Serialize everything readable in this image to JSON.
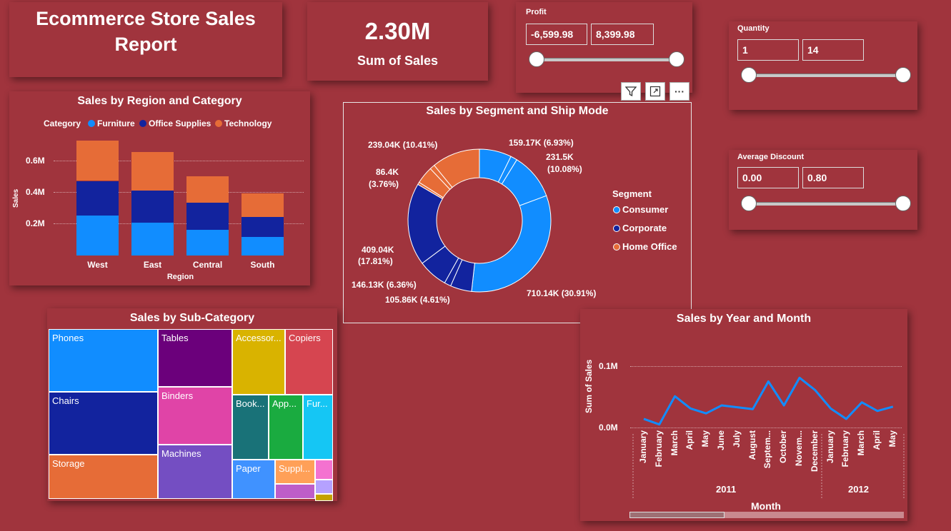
{
  "header": {
    "title_line1": "Ecommerce Store Sales",
    "title_line2": "Report"
  },
  "kpi": {
    "value": "2.30M",
    "label": "Sum of Sales"
  },
  "slicers": {
    "profit": {
      "title": "Profit",
      "min": "-6,599.98",
      "max": "8,399.98"
    },
    "quantity": {
      "title": "Quantity",
      "min": "1",
      "max": "14"
    },
    "discount": {
      "title": "Average Discount",
      "min": "0.00",
      "max": "0.80"
    }
  },
  "visual_toolbar": {
    "filter_icon": "filter-icon",
    "focus_icon": "focus-mode-icon",
    "more_icon": "more-options-icon",
    "more_label": "···"
  },
  "region_chart": {
    "title": "Sales by Region and Category",
    "legend_title": "Category",
    "legend": [
      "Furniture",
      "Office Supplies",
      "Technology"
    ],
    "ylabel": "Sales",
    "xlabel": "Region",
    "yticks": [
      "0.6M",
      "0.4M",
      "0.2M"
    ]
  },
  "segment_chart": {
    "title": "Sales by Segment and Ship Mode",
    "legend_title": "Segment",
    "legend": [
      "Consumer",
      "Corporate",
      "Home Office"
    ],
    "labels": {
      "a": "159.17K (6.93%)",
      "b1": "231.5K",
      "b2": "(10.08%)",
      "c": "710.14K (30.91%)",
      "d": "105.86K (4.61%)",
      "e": "146.13K (6.36%)",
      "f1": "409.04K",
      "f2": "(17.81%)",
      "g1": "86.4K",
      "g2": "(3.76%)",
      "h": "239.04K (10.41%)"
    }
  },
  "subcategory_chart": {
    "title": "Sales by Sub-Category",
    "tiles": {
      "phones": "Phones",
      "chairs": "Chairs",
      "storage": "Storage",
      "tables": "Tables",
      "binders": "Binders",
      "machines": "Machines",
      "accessories": "Accessor...",
      "copiers": "Copiers",
      "bookcases": "Book...",
      "appliances": "App...",
      "furnishings": "Fur...",
      "paper": "Paper",
      "supplies": "Suppl..."
    }
  },
  "month_chart": {
    "title": "Sales by Year and Month",
    "ylabel": "Sum of Sales",
    "xlabel": "Month",
    "yticks": [
      "0.1M",
      "0.0M"
    ],
    "months_2011": [
      "January",
      "February",
      "March",
      "April",
      "May",
      "June",
      "July",
      "August",
      "Septem...",
      "October",
      "Novem...",
      "December"
    ],
    "months_2012": [
      "January",
      "February",
      "March",
      "April",
      "May"
    ],
    "year_2011": "2011",
    "year_2012": "2012"
  },
  "chart_data": [
    {
      "type": "bar",
      "title": "Sales by Region and Category",
      "xlabel": "Region",
      "ylabel": "Sales",
      "categories": [
        "West",
        "East",
        "Central",
        "South"
      ],
      "series": [
        {
          "name": "Furniture",
          "values": [
            0.255,
            0.21,
            0.165,
            0.12
          ]
        },
        {
          "name": "Office Supplies",
          "values": [
            0.22,
            0.205,
            0.17,
            0.125
          ]
        },
        {
          "name": "Technology",
          "values": [
            0.255,
            0.245,
            0.17,
            0.15
          ]
        }
      ],
      "ylim": [
        0,
        0.7
      ],
      "grid": true,
      "legend": "top",
      "colors": [
        "#118dff",
        "#12239e",
        "#e66c37"
      ]
    },
    {
      "type": "pie",
      "title": "Sales by Segment and Ship Mode",
      "slices": [
        {
          "label": "159.17K (6.93%)",
          "value": 159.17,
          "segment": "Consumer"
        },
        {
          "label": "",
          "value": 33,
          "segment": "Consumer"
        },
        {
          "label": "231.5K (10.08%)",
          "value": 231.5,
          "segment": "Consumer"
        },
        {
          "label": "710.14K (30.91%)",
          "value": 710.14,
          "segment": "Consumer"
        },
        {
          "label": "105.86K (4.61%)",
          "value": 105.86,
          "segment": "Corporate"
        },
        {
          "label": "",
          "value": 33,
          "segment": "Corporate"
        },
        {
          "label": "146.13K (6.36%)",
          "value": 146.13,
          "segment": "Corporate"
        },
        {
          "label": "409.04K (17.81%)",
          "value": 409.04,
          "segment": "Corporate"
        },
        {
          "label": "",
          "value": 12,
          "segment": "Home Office"
        },
        {
          "label": "86.4K (3.76%)",
          "value": 86.4,
          "segment": "Home Office"
        },
        {
          "label": "",
          "value": 25,
          "segment": "Home Office"
        },
        {
          "label": "239.04K (10.41%)",
          "value": 239.04,
          "segment": "Home Office"
        }
      ],
      "colors": {
        "Consumer": "#118dff",
        "Corporate": "#12239e",
        "Home Office": "#e66c37"
      },
      "legend": "right"
    },
    {
      "type": "line",
      "title": "Sales by Year and Month",
      "xlabel": "Month",
      "ylabel": "Sum of Sales",
      "x": [
        "2011 January",
        "2011 February",
        "2011 March",
        "2011 April",
        "2011 May",
        "2011 June",
        "2011 July",
        "2011 August",
        "2011 September",
        "2011 October",
        "2011 November",
        "2011 December",
        "2012 January",
        "2012 February",
        "2012 March",
        "2012 April",
        "2012 May"
      ],
      "values": [
        0.014,
        0.005,
        0.051,
        0.031,
        0.023,
        0.036,
        0.033,
        0.03,
        0.075,
        0.036,
        0.081,
        0.061,
        0.031,
        0.014,
        0.041,
        0.027,
        0.034
      ],
      "ylim": [
        0,
        0.12
      ],
      "grid": true,
      "color": "#118dff"
    }
  ]
}
